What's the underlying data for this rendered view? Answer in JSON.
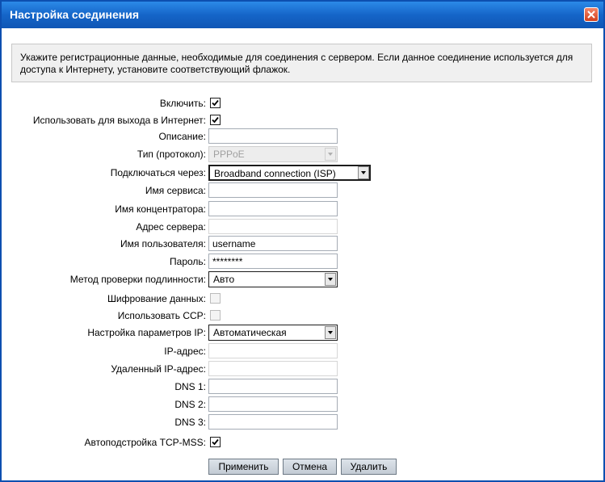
{
  "window": {
    "title": "Настройка соединения"
  },
  "info_text": "Укажите регистрационные данные, необходимые для соединения с сервером. Если данное соединение используется для доступа к Интернету, установите соответствующий флажок.",
  "form": {
    "enable_label": "Включить:",
    "enable_checked": true,
    "internet_label": "Использовать для выхода в Интернет:",
    "internet_checked": true,
    "description_label": "Описание:",
    "description_value": "",
    "type_label": "Тип (протокол):",
    "type_value": "PPPoE",
    "connect_via_label": "Подключаться через:",
    "connect_via_value": "Broadband connection (ISP)",
    "service_label": "Имя сервиса:",
    "service_value": "",
    "concentrator_label": "Имя концентратора:",
    "concentrator_value": "",
    "server_label": "Адрес сервера:",
    "server_value": "",
    "username_label": "Имя пользователя:",
    "username_value": "username",
    "password_label": "Пароль:",
    "password_value": "********",
    "auth_label": "Метод проверки подлинности:",
    "auth_value": "Авто",
    "encryption_label": "Шифрование данных:",
    "encryption_checked": false,
    "ccp_label": "Использовать CCP:",
    "ccp_checked": false,
    "ip_settings_label": "Настройка параметров IP:",
    "ip_settings_value": "Автоматическая",
    "ip_label": "IP-адрес:",
    "ip_value": "",
    "remote_ip_label": "Удаленный IP-адрес:",
    "remote_ip_value": "",
    "dns1_label": "DNS 1:",
    "dns1_value": "",
    "dns2_label": "DNS 2:",
    "dns2_value": "",
    "dns3_label": "DNS 3:",
    "dns3_value": "",
    "tcpmss_label": "Автоподстройка TCP-MSS:",
    "tcpmss_checked": true
  },
  "buttons": {
    "apply": "Применить",
    "cancel": "Отмена",
    "delete": "Удалить"
  },
  "colors": {
    "titlebar": "#1565c8",
    "close": "#d2401c",
    "info_bg": "#f0f0f0"
  }
}
